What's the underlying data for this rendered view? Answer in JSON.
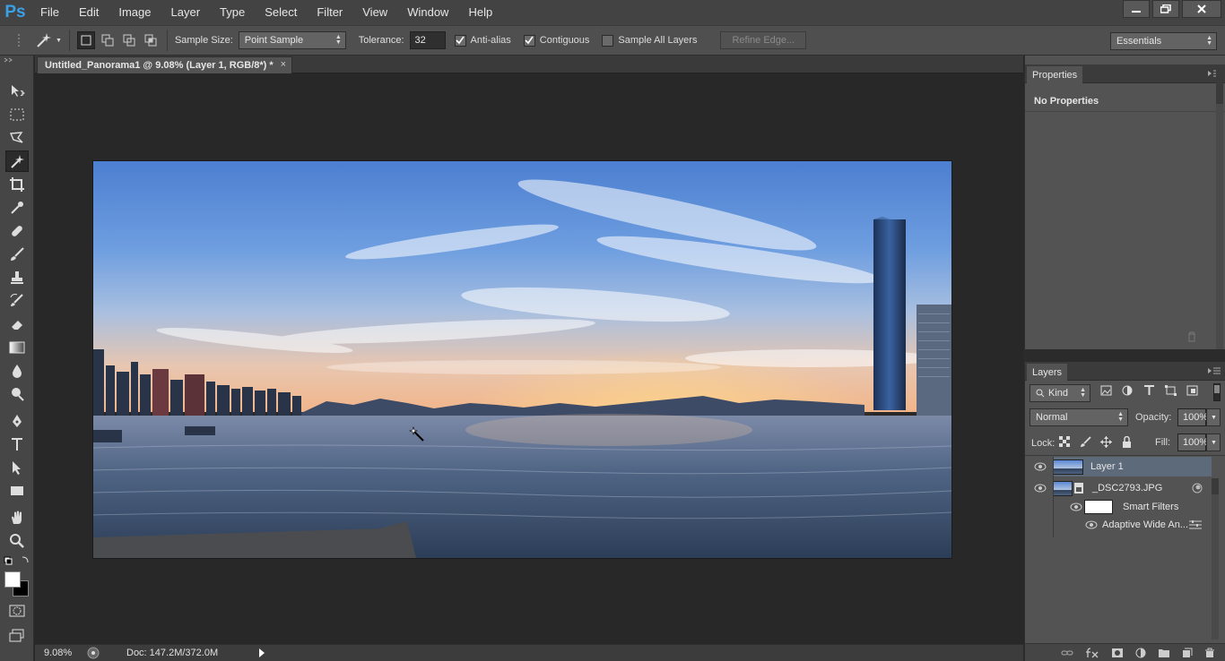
{
  "menu": {
    "logo": "Ps",
    "items": [
      "File",
      "Edit",
      "Image",
      "Layer",
      "Type",
      "Select",
      "Filter",
      "View",
      "Window",
      "Help"
    ]
  },
  "options": {
    "sample_size_label": "Sample Size:",
    "sample_size_value": "Point Sample",
    "tolerance_label": "Tolerance:",
    "tolerance_value": "32",
    "anti_alias_label": "Anti-alias",
    "contiguous_label": "Contiguous",
    "sample_all_layers_label": "Sample All Layers",
    "refine_edge_label": "Refine Edge...",
    "workspace_value": "Essentials",
    "anti_alias_checked": true,
    "contiguous_checked": true,
    "sample_all_checked": false
  },
  "document": {
    "tab_title": "Untitled_Panorama1 @ 9.08% (Layer 1, RGB/8*) *",
    "close_glyph": "×"
  },
  "status": {
    "zoom": "9.08%",
    "doc_size": "Doc: 147.2M/372.0M"
  },
  "properties": {
    "tab_label": "Properties",
    "body": "No Properties"
  },
  "layers": {
    "tab_label": "Layers",
    "filter_value": "Kind",
    "blend_mode": "Normal",
    "opacity_label": "Opacity:",
    "opacity_value": "100%",
    "lock_label": "Lock:",
    "fill_label": "Fill:",
    "fill_value": "100%",
    "items": [
      {
        "name": "Layer 1"
      },
      {
        "name": "_DSC2793.JPG"
      },
      {
        "name": "Smart Filters"
      },
      {
        "name": "Adaptive Wide An..."
      }
    ]
  },
  "colors": {
    "accent": "#3aa0e8",
    "selected_row": "#5c6a7a"
  }
}
